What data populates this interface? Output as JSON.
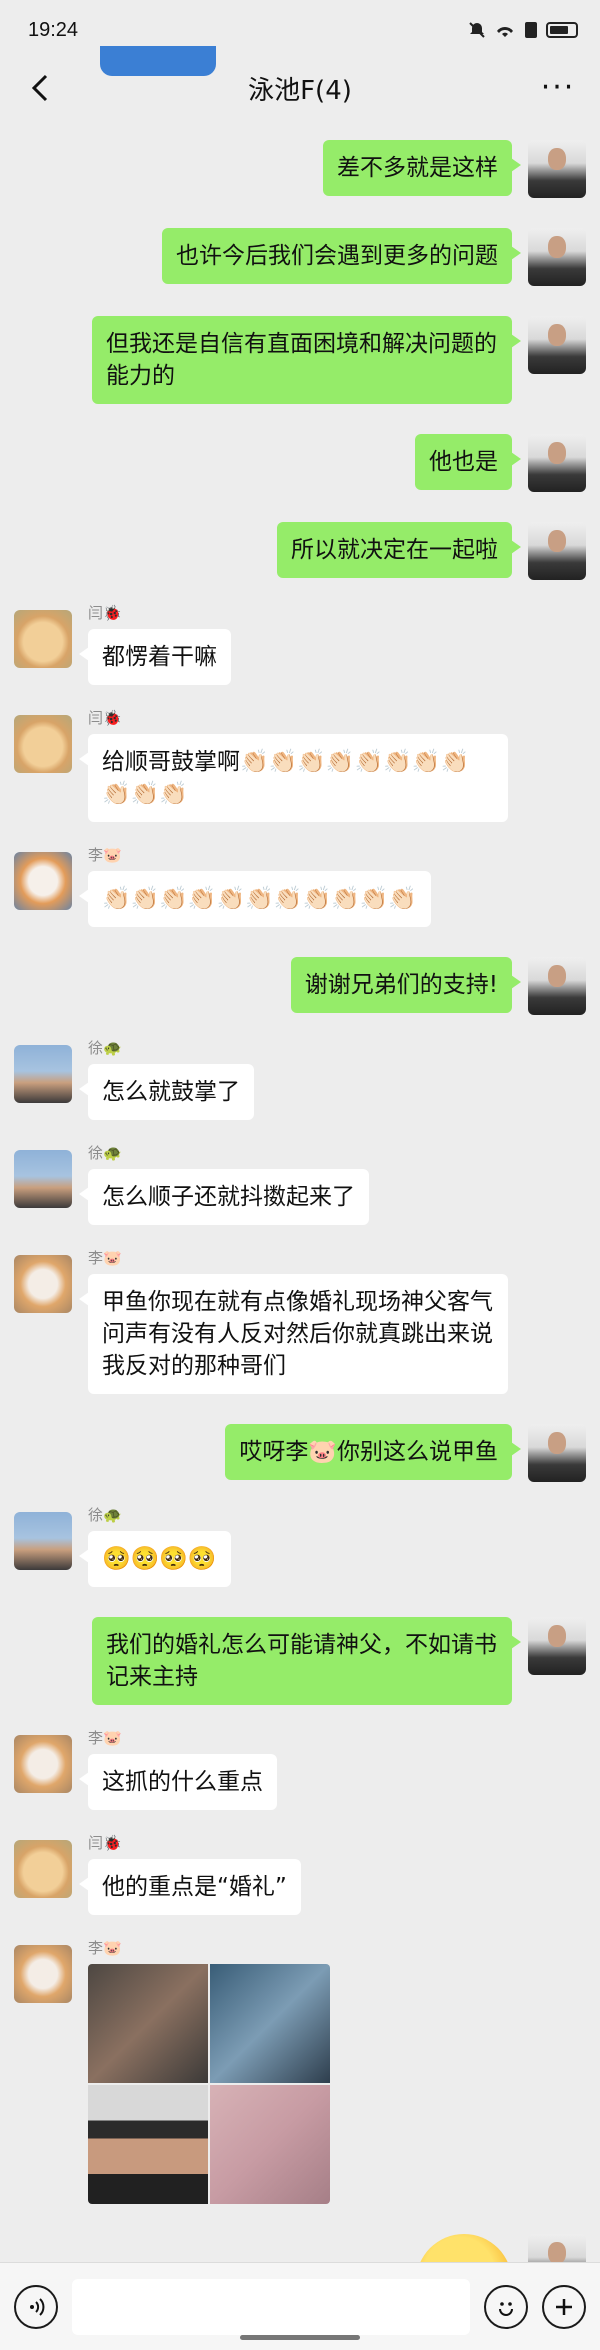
{
  "status": {
    "time": "19:24"
  },
  "nav": {
    "title": "泳池F(4)",
    "back_icon": "‹",
    "more_icon": "···"
  },
  "messages": [
    {
      "side": "me",
      "text": "差不多就是这样"
    },
    {
      "side": "me",
      "text": "也许今后我们会遇到更多的问题"
    },
    {
      "side": "me",
      "text": "但我还是自信有直面困境和解决问题的能力的"
    },
    {
      "side": "me",
      "text": "他也是"
    },
    {
      "side": "me",
      "text": "所以就决定在一起啦"
    },
    {
      "side": "other",
      "sender": "闫🐞",
      "text": "都愣着干嘛"
    },
    {
      "side": "other",
      "sender": "闫🐞",
      "text": "给顺哥鼓掌啊👏🏻👏🏻👏🏻👏🏻👏🏻👏🏻👏🏻👏🏻👏🏻👏🏻👏🏻"
    },
    {
      "side": "other",
      "sender": "李🐷",
      "text": "👏🏻👏🏻👏🏻👏🏻👏🏻👏🏻👏🏻👏🏻👏🏻👏🏻👏🏻"
    },
    {
      "side": "me",
      "text": "谢谢兄弟们的支持!"
    },
    {
      "side": "other",
      "sender": "徐🐢",
      "text": "怎么就鼓掌了"
    },
    {
      "side": "other",
      "sender": "徐🐢",
      "text": "怎么顺子还就抖擞起来了"
    },
    {
      "side": "other",
      "sender": "李🐷",
      "text": "甲鱼你现在就有点像婚礼现场神父客气问声有没有人反对然后你就真跳出来说我反对的那种哥们"
    },
    {
      "side": "me",
      "text": "哎呀李🐷你别这么说甲鱼"
    },
    {
      "side": "other",
      "sender": "徐🐢",
      "text": "🥺🥺🥺🥺"
    },
    {
      "side": "me",
      "text": "我们的婚礼怎么可能请神父，不如请书记来主持"
    },
    {
      "side": "other",
      "sender": "李🐷",
      "text": "这抓的什么重点"
    },
    {
      "side": "other",
      "sender": "闫🐞",
      "text": "他的重点是“婚礼”"
    },
    {
      "side": "other",
      "sender": "李🐷"
    },
    {
      "side": "me"
    }
  ]
}
